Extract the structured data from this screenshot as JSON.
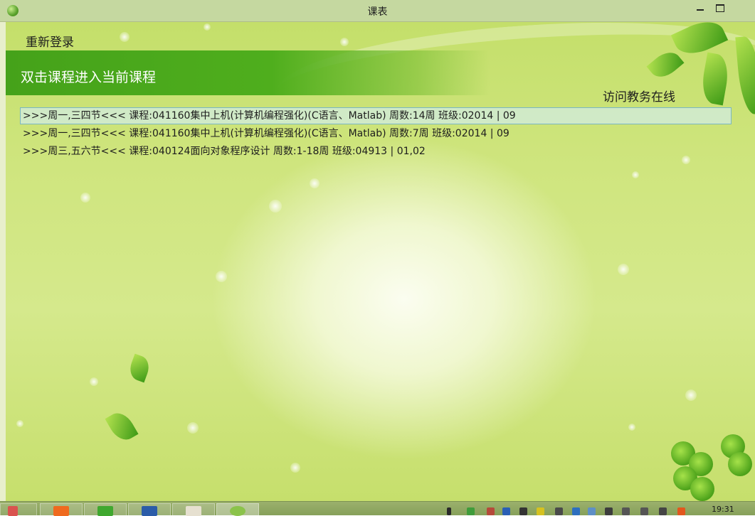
{
  "window": {
    "title": "课表"
  },
  "toolbar": {
    "relogin_label": "重新登录",
    "visit_label": "访问教务在线"
  },
  "main": {
    "hint": "双击课程进入当前课程",
    "courses": [
      {
        "text": ">>>周一,三四节<<< 课程:041160集中上机(计算机编程强化)(C语言、Matlab) 周数:14周 班级:02014 | 09",
        "selected": true
      },
      {
        "text": ">>>周一,三四节<<< 课程:041160集中上机(计算机编程强化)(C语言、Matlab) 周数:7周 班级:02014 | 09",
        "selected": false
      },
      {
        "text": ">>>周三,五六节<<< 课程:040124面向对象程序设计 周数:1-18周 班级:04913 | 01,02",
        "selected": false
      }
    ]
  },
  "taskbar": {
    "clock": "19:31",
    "apps": [
      {
        "name": "start",
        "color": "#d9534f"
      },
      {
        "name": "app-orange",
        "color": "#ef6a1f"
      },
      {
        "name": "qt-creator",
        "color": "#3fa82f"
      },
      {
        "name": "word",
        "color": "#2b5ca8"
      },
      {
        "name": "app-owl",
        "color": "#e6e0d0"
      },
      {
        "name": "schedule-app",
        "color": "#8bc34a"
      }
    ]
  },
  "colors": {
    "band": "#4fae1d",
    "selection_border": "#7ab6c2",
    "background": "#cfe57e"
  }
}
